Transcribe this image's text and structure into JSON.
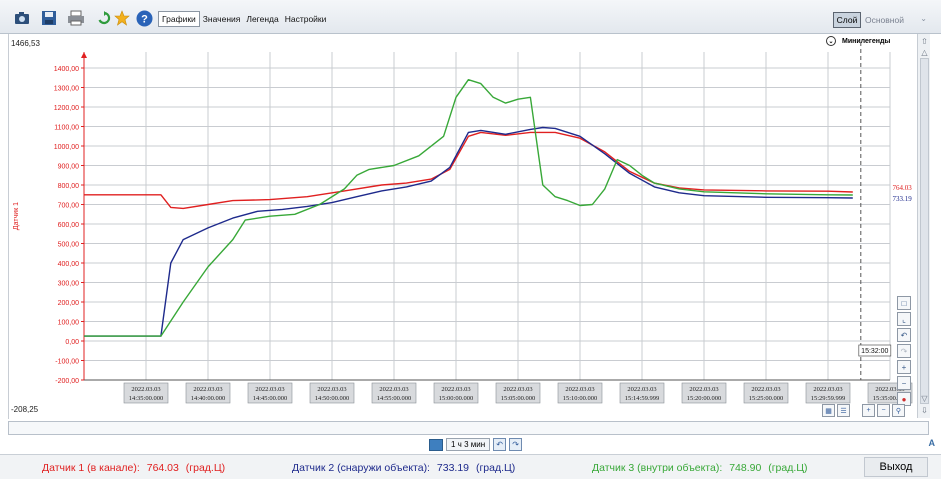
{
  "toolbar": {
    "icons": [
      "camera-icon",
      "save-icon",
      "print-icon",
      "refresh-icon",
      "star-icon",
      "help-icon"
    ],
    "tabs": [
      {
        "label": "Графики",
        "active": true
      },
      {
        "label": "Значения",
        "active": false
      },
      {
        "label": "Легенда",
        "active": false
      },
      {
        "label": "Настройки",
        "active": false
      }
    ],
    "layer_button": "Слой",
    "layer_select_value": "Основной"
  },
  "chart": {
    "top_value": "1466,53",
    "bottom_value": "-208,25",
    "minilegend": "Минилегенды",
    "cursor_time": "15:32:00",
    "end_labels": [
      "764.03",
      "733.19"
    ]
  },
  "chart_data": {
    "type": "line",
    "ylabel": "Датчик 1",
    "ylim": [
      -208.25,
      1466.53
    ],
    "yticks": [
      "-200,00",
      "-100,00",
      "0,00",
      "100,00",
      "200,00",
      "300,00",
      "400,00",
      "500,00",
      "600,00",
      "700,00",
      "800,00",
      "900,00",
      "1000,00",
      "1100,00",
      "1200,00",
      "1300,00",
      "1400,00"
    ],
    "ytick_values": [
      -200,
      -100,
      0,
      100,
      200,
      300,
      400,
      500,
      600,
      700,
      800,
      900,
      1000,
      1100,
      1200,
      1300,
      1400
    ],
    "xlim_minutes": [
      0,
      62
    ],
    "x_label_minutes": [
      5,
      10,
      15,
      20,
      25,
      30,
      35,
      40,
      45,
      50,
      55,
      60,
      65
    ],
    "x_labels": [
      [
        "2022.03.03",
        "14:35:00.000"
      ],
      [
        "2022.03.03",
        "14:40:00.000"
      ],
      [
        "2022.03.03",
        "14:45:00.000"
      ],
      [
        "2022.03.03",
        "14:50:00.000"
      ],
      [
        "2022.03.03",
        "14:55:00.000"
      ],
      [
        "2022.03.03",
        "15:00:00.000"
      ],
      [
        "2022.03.03",
        "15:05:00.000"
      ],
      [
        "2022.03.03",
        "15:10:00.000"
      ],
      [
        "2022.03.03",
        "15:14:59.999"
      ],
      [
        "2022.03.03",
        "15:20:00.000"
      ],
      [
        "2022.03.03",
        "15:25:00.000"
      ],
      [
        "2022.03.03",
        "15:29:59.999"
      ],
      [
        "2022.03.03",
        "15:35:00.000"
      ]
    ],
    "grid": true,
    "series": [
      {
        "name": "Датчик 1 (в канале)",
        "color": "#e02020",
        "x": [
          0,
          4,
          6.2,
          7,
          8,
          10,
          12,
          15,
          18,
          21,
          24,
          26,
          28,
          29.5,
          31,
          32,
          34,
          36,
          38,
          40,
          42,
          44,
          46,
          48,
          50,
          55,
          60,
          62
        ],
        "y": [
          750,
          750,
          750,
          685,
          680,
          700,
          720,
          725,
          740,
          770,
          800,
          810,
          830,
          880,
          1050,
          1070,
          1055,
          1070,
          1070,
          1040,
          970,
          870,
          810,
          785,
          775,
          770,
          768,
          764.03
        ]
      },
      {
        "name": "Датчик 2 (снаружи объекта)",
        "color": "#1e2a8c",
        "x": [
          0,
          4,
          6.2,
          7,
          8,
          10,
          12,
          14,
          16,
          18,
          20,
          22,
          24,
          26,
          28,
          29.5,
          31,
          32,
          34,
          36,
          37,
          38,
          40,
          42,
          44,
          46,
          48,
          50,
          55,
          60,
          62
        ],
        "y": [
          25,
          25,
          25,
          400,
          520,
          580,
          630,
          665,
          675,
          690,
          710,
          740,
          770,
          790,
          820,
          890,
          1070,
          1080,
          1060,
          1085,
          1095,
          1090,
          1050,
          960,
          860,
          790,
          760,
          745,
          737,
          735,
          733.19
        ]
      },
      {
        "name": "Датчик 3 (внутри объекта)",
        "color": "#38a838",
        "x": [
          0,
          4,
          6.2,
          8,
          10,
          12,
          13,
          15,
          17,
          19,
          21,
          22,
          23,
          25,
          27,
          29,
          30,
          31,
          32,
          33,
          34,
          35,
          36,
          37,
          38,
          39,
          40,
          41,
          42,
          43,
          44,
          45,
          46,
          48,
          50,
          55,
          60,
          62
        ],
        "y": [
          25,
          25,
          25,
          200,
          380,
          520,
          620,
          640,
          650,
          700,
          780,
          850,
          880,
          900,
          950,
          1050,
          1250,
          1340,
          1320,
          1250,
          1220,
          1240,
          1250,
          800,
          740,
          720,
          695,
          700,
          780,
          930,
          900,
          850,
          810,
          780,
          765,
          755,
          750,
          748.9
        ]
      }
    ]
  },
  "timebar": {
    "span_label": "1 ч 3 мин",
    "right_letter": "A"
  },
  "status": {
    "sensors": [
      {
        "label": "Датчик 1 (в канале):",
        "value": "764.03",
        "unit": "(град.Ц)",
        "color": "#e02020"
      },
      {
        "label": "Датчик 2 (снаружи объекта):",
        "value": "733.19",
        "unit": "(град.Ц)",
        "color": "#1e2a8c"
      },
      {
        "label": "Датчик 3 (внутри объекта):",
        "value": "748.90",
        "unit": "(град.Ц)",
        "color": "#38a838"
      }
    ],
    "exit_button": "Выход"
  }
}
